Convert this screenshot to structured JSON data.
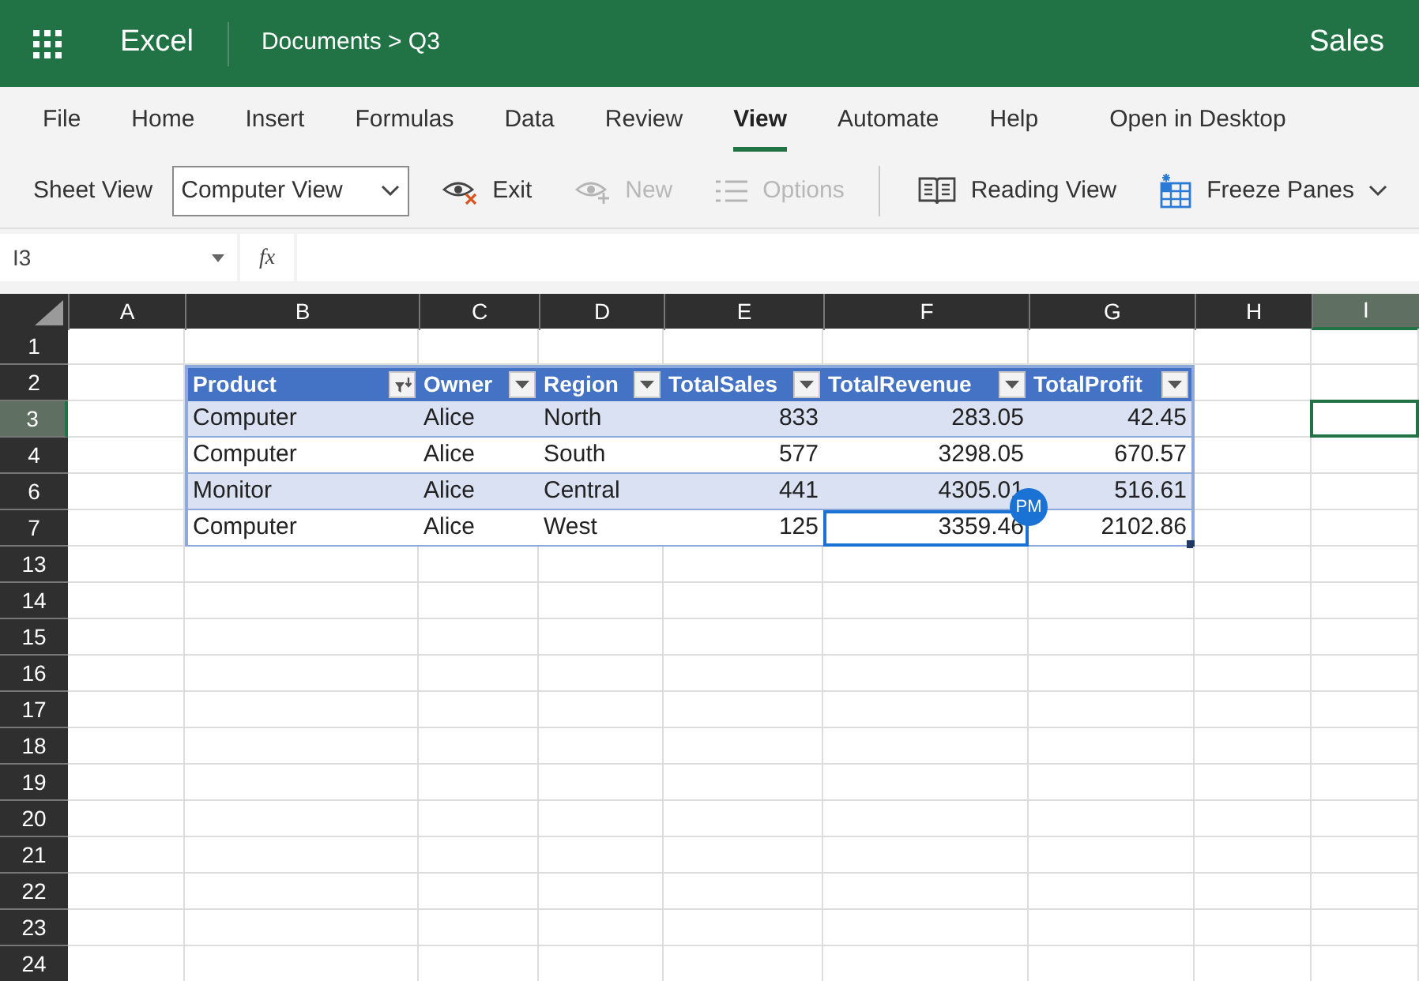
{
  "header": {
    "app_name": "Excel",
    "breadcrumb": "Documents > Q3",
    "doc_title": "Sales"
  },
  "ribbon_tabs": [
    {
      "label": "File",
      "selected": false
    },
    {
      "label": "Home",
      "selected": false
    },
    {
      "label": "Insert",
      "selected": false
    },
    {
      "label": "Formulas",
      "selected": false
    },
    {
      "label": "Data",
      "selected": false
    },
    {
      "label": "Review",
      "selected": false
    },
    {
      "label": "View",
      "selected": true
    },
    {
      "label": "Automate",
      "selected": false
    },
    {
      "label": "Help",
      "selected": false
    },
    {
      "label": "Open in Desktop",
      "selected": false
    }
  ],
  "toolbar": {
    "sheet_view_label": "Sheet View",
    "sheet_view_value": "Computer View",
    "buttons": [
      {
        "kind": "exit",
        "label": "Exit",
        "disabled": false
      },
      {
        "kind": "new",
        "label": "New",
        "disabled": true
      },
      {
        "kind": "options",
        "label": "Options",
        "disabled": true
      },
      {
        "kind": "reading",
        "label": "Reading View",
        "disabled": false
      },
      {
        "kind": "freeze",
        "label": "Freeze Panes",
        "disabled": false
      }
    ]
  },
  "formula_bar": {
    "name_box": "I3",
    "function_label": "fx"
  },
  "sheet": {
    "columns": [
      {
        "label": "A",
        "selected": false
      },
      {
        "label": "B",
        "selected": false
      },
      {
        "label": "C",
        "selected": false
      },
      {
        "label": "D",
        "selected": false
      },
      {
        "label": "E",
        "selected": false
      },
      {
        "label": "F",
        "selected": false
      },
      {
        "label": "G",
        "selected": false
      },
      {
        "label": "H",
        "selected": false
      },
      {
        "label": "I",
        "selected": true
      }
    ],
    "rows": [
      {
        "number": "1",
        "selected": false
      },
      {
        "number": "2",
        "selected": false
      },
      {
        "number": "3",
        "selected": true
      },
      {
        "number": "4",
        "selected": false
      },
      {
        "number": "6",
        "selected": false
      },
      {
        "number": "7",
        "selected": false
      },
      {
        "number": "13",
        "selected": false
      },
      {
        "number": "14",
        "selected": false
      },
      {
        "number": "15",
        "selected": false
      },
      {
        "number": "16",
        "selected": false
      },
      {
        "number": "17",
        "selected": false
      },
      {
        "number": "18",
        "selected": false
      },
      {
        "number": "19",
        "selected": false
      },
      {
        "number": "20",
        "selected": false
      },
      {
        "number": "21",
        "selected": false
      },
      {
        "number": "22",
        "selected": false
      },
      {
        "number": "23",
        "selected": false
      },
      {
        "number": "24",
        "selected": false
      }
    ]
  },
  "table": {
    "headers": [
      {
        "label": "Product",
        "kind": "text",
        "filtered": true
      },
      {
        "label": "Owner",
        "kind": "text",
        "filtered": false
      },
      {
        "label": "Region",
        "kind": "text",
        "filtered": false
      },
      {
        "label": "TotalSales",
        "kind": "number",
        "filtered": false
      },
      {
        "label": "TotalRevenue",
        "kind": "number",
        "filtered": false
      },
      {
        "label": "TotalProfit",
        "kind": "number",
        "filtered": false
      }
    ],
    "rows": [
      {
        "cells": [
          {
            "text": "Computer",
            "selected": false
          },
          {
            "text": "Alice",
            "selected": false
          },
          {
            "text": "North",
            "selected": false
          },
          {
            "text": "833",
            "selected": false
          },
          {
            "text": "283.05",
            "selected": false
          },
          {
            "text": "42.45",
            "selected": false
          }
        ]
      },
      {
        "cells": [
          {
            "text": "Computer",
            "selected": false
          },
          {
            "text": "Alice",
            "selected": false
          },
          {
            "text": "South",
            "selected": false
          },
          {
            "text": "577",
            "selected": false
          },
          {
            "text": "3298.05",
            "selected": false
          },
          {
            "text": "670.57",
            "selected": false
          }
        ]
      },
      {
        "cells": [
          {
            "text": "Monitor",
            "selected": false
          },
          {
            "text": "Alice",
            "selected": false
          },
          {
            "text": "Central",
            "selected": false
          },
          {
            "text": "441",
            "selected": false
          },
          {
            "text": "4305.01",
            "selected": false
          },
          {
            "text": "516.61",
            "selected": false
          }
        ]
      },
      {
        "cells": [
          {
            "text": "Computer",
            "selected": false
          },
          {
            "text": "Alice",
            "selected": false
          },
          {
            "text": "West",
            "selected": false
          },
          {
            "text": "125",
            "selected": false
          },
          {
            "text": "3359.46",
            "selected": true,
            "presence": "PM"
          },
          {
            "text": "2102.86",
            "selected": false
          }
        ]
      }
    ]
  }
}
